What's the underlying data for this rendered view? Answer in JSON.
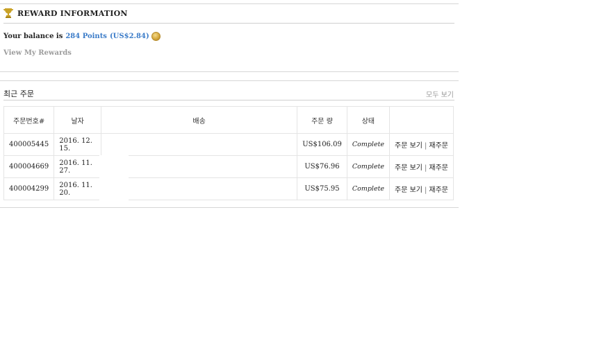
{
  "reward": {
    "title": "REWARD INFORMATION",
    "balance_prefix": "Your balance is",
    "points": "284 Points",
    "usd": "(US$2.84)",
    "view_rewards": "View My Rewards"
  },
  "orders": {
    "title": "최근 주문",
    "view_all": "모두 보기",
    "columns": [
      "주문번호#",
      "날자",
      "배송",
      "주문 량",
      "상태",
      ""
    ],
    "rows": [
      {
        "id": "400005445",
        "date": "2016. 12. 15.",
        "shipping": "",
        "amount": "US$106.09",
        "status": "Complete",
        "view": "주문 보기",
        "sep": "|",
        "reorder": "재주문"
      },
      {
        "id": "400004669",
        "date": "2016. 11. 27.",
        "shipping": "",
        "amount": "US$76.96",
        "status": "Complete",
        "view": "주문 보기",
        "sep": "|",
        "reorder": "재주문"
      },
      {
        "id": "400004299",
        "date": "2016. 11. 20.",
        "shipping": "",
        "amount": "US$75.95",
        "status": "Complete",
        "view": "주문 보기",
        "sep": "|",
        "reorder": "재주문"
      }
    ]
  },
  "icons": {
    "trophy": "trophy-icon",
    "coin": "coin-icon"
  },
  "colors": {
    "link_blue": "#3a7bc8",
    "muted_gray": "#9c9c9c",
    "trophy_gold": "#c9a227"
  }
}
